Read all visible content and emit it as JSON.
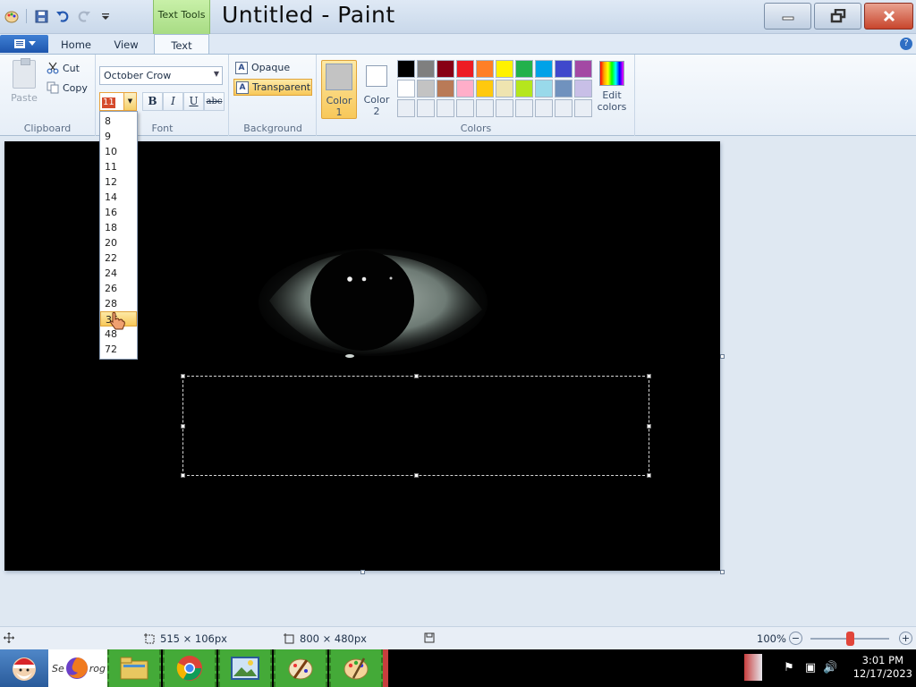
{
  "title_bar": {
    "app_title": "Untitled - Paint",
    "context_tab": "Text Tools"
  },
  "tabs": {
    "home": "Home",
    "view": "View",
    "text": "Text"
  },
  "ribbon": {
    "clipboard": {
      "label": "Clipboard",
      "paste": "Paste",
      "cut": "Cut",
      "copy": "Copy"
    },
    "font": {
      "label": "Font",
      "font_name": "October Crow",
      "font_size": "11",
      "bold": "B",
      "italic": "I",
      "underline": "U",
      "strikethrough": "abc"
    },
    "background": {
      "label": "Background",
      "opaque": "Opaque",
      "transparent": "Transparent"
    },
    "colors": {
      "label": "Colors",
      "color1_line1": "Color",
      "color1_line2": "1",
      "color2_line1": "Color",
      "color2_line2": "2",
      "color1_value": "#c3c3c3",
      "color2_value": "#ffffff",
      "edit_line1": "Edit",
      "edit_line2": "colors",
      "palette": [
        "#000000",
        "#7f7f7f",
        "#880015",
        "#ed1c24",
        "#ff7f27",
        "#fff200",
        "#22b14c",
        "#00a2e8",
        "#3f48cc",
        "#a349a4",
        "#ffffff",
        "#c3c3c3",
        "#b97a57",
        "#ffaec9",
        "#ffc90e",
        "#efe4b0",
        "#b5e61d",
        "#99d9ea",
        "#7092be",
        "#c8bfe7",
        "#e9eef5",
        "#e9eef5",
        "#e9eef5",
        "#e9eef5",
        "#e9eef5",
        "#e9eef5",
        "#e9eef5",
        "#e9eef5",
        "#e9eef5",
        "#e9eef5"
      ]
    }
  },
  "size_dropdown": {
    "options": [
      "8",
      "9",
      "10",
      "11",
      "12",
      "14",
      "16",
      "18",
      "20",
      "22",
      "24",
      "26",
      "28",
      "36",
      "48",
      "72"
    ],
    "highlighted": "36"
  },
  "status_bar": {
    "selection_size": "515 × 106px",
    "image_size": "800 × 480px",
    "zoom": "100%",
    "zoom_fraction": 0.5
  },
  "taskbar": {
    "firefox_label": "Se",
    "firefox_label2": "rog",
    "time": "3:01 PM",
    "date": "12/17/2023"
  }
}
